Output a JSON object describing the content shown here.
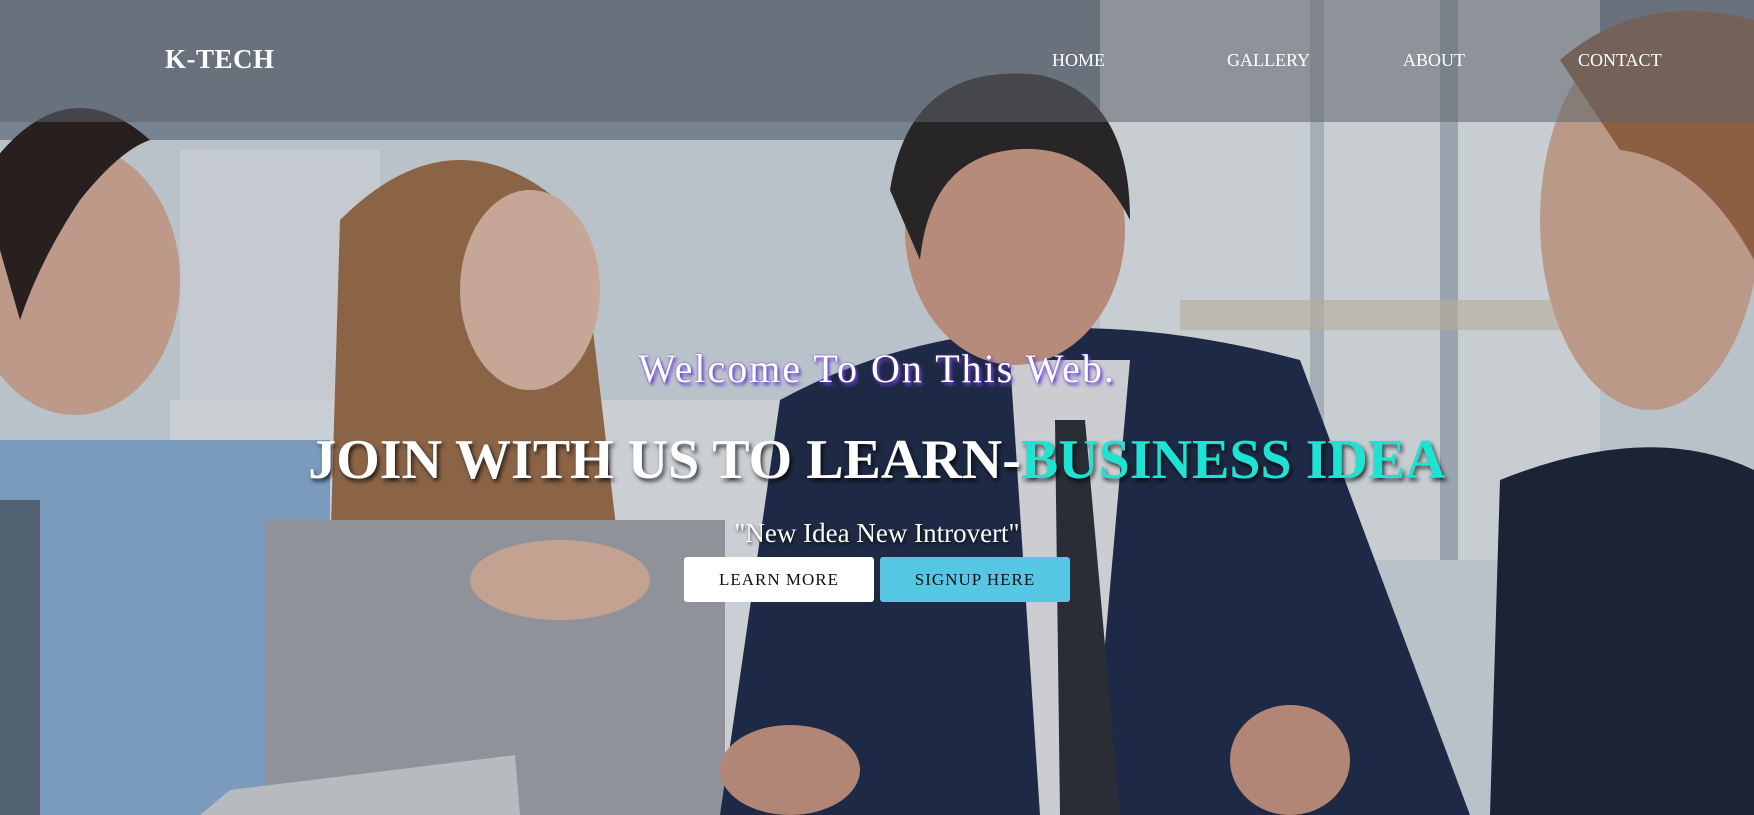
{
  "brand": "K-TECH",
  "nav": {
    "home": "HOME",
    "gallery": "GALLERY",
    "about": "ABOUT",
    "contact": "CONTACT"
  },
  "hero": {
    "welcome": "Welcome To On This Web.",
    "headline_main": "JOIN WITH US TO LEARN-",
    "headline_accent": "BUSINESS IDEA",
    "tagline": "\"New Idea New Introvert\"",
    "learn_more_label": "LEARN MORE",
    "signup_label": "SIGNUP HERE"
  },
  "colors": {
    "accent": "#1ee3d3",
    "signup_button": "#56c7e2",
    "welcome_glow": "#6a3fd6"
  }
}
